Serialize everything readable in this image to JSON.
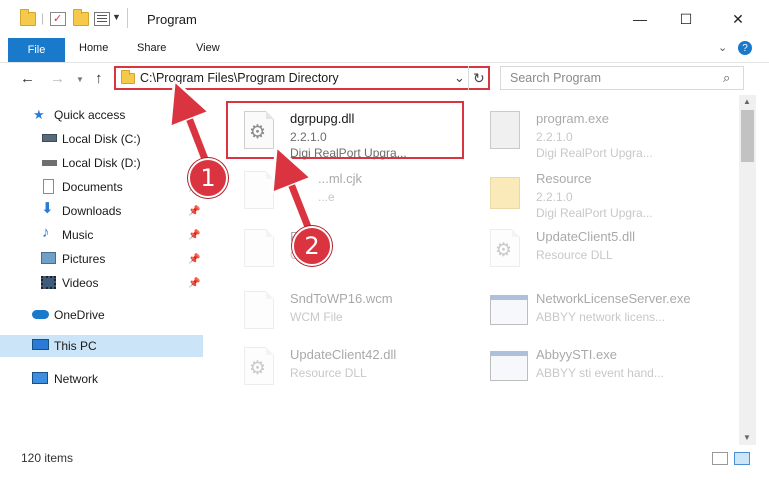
{
  "window": {
    "title": "Program",
    "minimize_glyph": "—",
    "maximize_glyph": "☐",
    "close_glyph": "✕"
  },
  "ribbon": {
    "tabs": [
      "File",
      "Home",
      "Share",
      "View"
    ]
  },
  "address": {
    "path": "C:\\Program Files\\Program Directory",
    "search_placeholder": "Search Program"
  },
  "sidebar": {
    "items": [
      {
        "label": "Quick access",
        "icon": "star-icon"
      },
      {
        "label": "Local Disk (C:)",
        "icon": "drive-icon"
      },
      {
        "label": "Local Disk (D:)",
        "icon": "drive-icon"
      },
      {
        "label": "Documents",
        "icon": "documents-icon"
      },
      {
        "label": "Downloads",
        "icon": "download-icon"
      },
      {
        "label": "Music",
        "icon": "music-icon"
      },
      {
        "label": "Pictures",
        "icon": "pictures-icon"
      },
      {
        "label": "Videos",
        "icon": "videos-icon"
      },
      {
        "label": "OneDrive",
        "icon": "cloud-icon"
      },
      {
        "label": "This PC",
        "icon": "computer-icon"
      },
      {
        "label": "Network",
        "icon": "network-icon"
      }
    ]
  },
  "files": [
    {
      "name": "dgrpupg.dll",
      "line2": "2.2.1.0",
      "line3": "Digi RealPort Upgra...",
      "icon": "dll-gear-icon"
    },
    {
      "name": "program.exe",
      "line2": "2.2.1.0",
      "line3": "Digi RealPort Upgra...",
      "icon": "exe-icon"
    },
    {
      "name": "...ml.cjk",
      "line2": "...e",
      "line3": "",
      "icon": "file-icon"
    },
    {
      "name": "Resource",
      "line2": "2.2.1.0",
      "line3": "Digi RealPort Upgra...",
      "icon": "folder-icon"
    },
    {
      "name": "Fa...jk",
      "line2": "C...",
      "line3": "",
      "icon": "file-icon"
    },
    {
      "name": "UpdateClient5.dll",
      "line2": "Resource DLL",
      "line3": "",
      "icon": "dll-gear-icon"
    },
    {
      "name": "SndToWP16.wcm",
      "line2": "WCM File",
      "line3": "",
      "icon": "file-icon"
    },
    {
      "name": "NetworkLicenseServer.exe",
      "line2": "ABBYY network licens...",
      "line3": "",
      "icon": "exe-window-icon"
    },
    {
      "name": "UpdateClient42.dll",
      "line2": "Resource DLL",
      "line3": "",
      "icon": "dll-gear-icon"
    },
    {
      "name": "AbbyySTI.exe",
      "line2": "ABBYY sti event hand...",
      "line3": "",
      "icon": "exe-window-icon"
    }
  ],
  "status": {
    "count": "120 items"
  },
  "callouts": [
    "1",
    "2"
  ],
  "colors": {
    "accent": "#1979ca",
    "highlight": "#d9343f",
    "selected": "#cce4f7"
  }
}
